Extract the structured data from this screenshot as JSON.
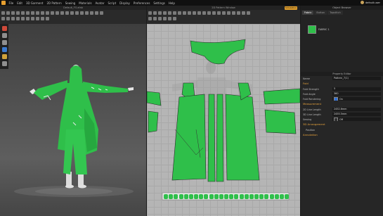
{
  "menubar": {
    "items": [
      "File",
      "Edit",
      "3D Garment",
      "2D Pattern",
      "Sewing",
      "Materials",
      "Avatar",
      "Script",
      "Display",
      "Preferences",
      "Settings",
      "Help"
    ],
    "user_name": "default.user"
  },
  "viewport3d": {
    "title": "Default_FO.zfab"
  },
  "viewport2d": {
    "title": "2D Pattern Window",
    "button": "Simulation"
  },
  "right_panel": {
    "title": "Object Browser",
    "tabs": [
      "Fabric",
      "Button",
      "Topstitch"
    ],
    "fabric_item": "FABRIC 1",
    "property_title": "Property Editor",
    "name_label": "Name",
    "name_value": "Pattern_7(1)",
    "sections": {
      "fold": "Fold",
      "measurement": "Measurement",
      "arrangement": "3D Arrangement",
      "annotation": "Annotation"
    },
    "properties": [
      {
        "label": "Fold Strength",
        "value": "5"
      },
      {
        "label": "Fold Angle",
        "value": "360"
      },
      {
        "label": "Fold Rendering",
        "value": "On"
      }
    ],
    "measurements": [
      {
        "label": "2D Line Length",
        "value": "2452.6mm"
      },
      {
        "label": "3D Line Length",
        "value": "2455.5mm"
      },
      {
        "label": "Sewing",
        "value": "Off"
      }
    ],
    "arrangement_item": "Position"
  },
  "colors": {
    "garment": "#2fbf4a",
    "accent": "#e09e2c"
  }
}
